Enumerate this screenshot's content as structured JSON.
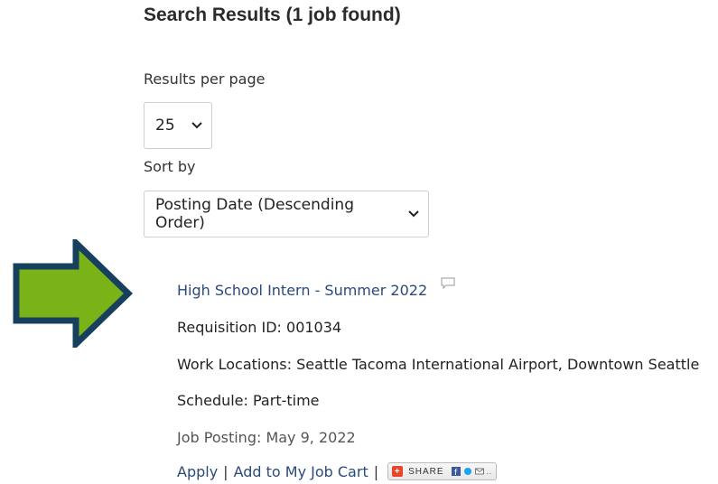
{
  "header": {
    "title": "Search Results (1 job found)"
  },
  "results_per_page": {
    "label": "Results per page",
    "value": "25"
  },
  "sort": {
    "label": "Sort by",
    "value": "Posting Date (Descending Order)"
  },
  "colors": {
    "arrow_fill": "#7ab317",
    "arrow_border": "#17405e",
    "link": "#2a4a7a"
  },
  "job": {
    "title": "High School Intern - Summer 2022",
    "requisition": "Requisition ID: 001034",
    "locations": "Work Locations: Seattle Tacoma International Airport, Downtown Seattle",
    "schedule": "Schedule: Part-time",
    "posting": "Job Posting: May 9, 2022"
  },
  "actions": {
    "apply": "Apply",
    "separator": "|",
    "add_to_cart": "Add to My Job Cart",
    "share": "SHARE"
  }
}
